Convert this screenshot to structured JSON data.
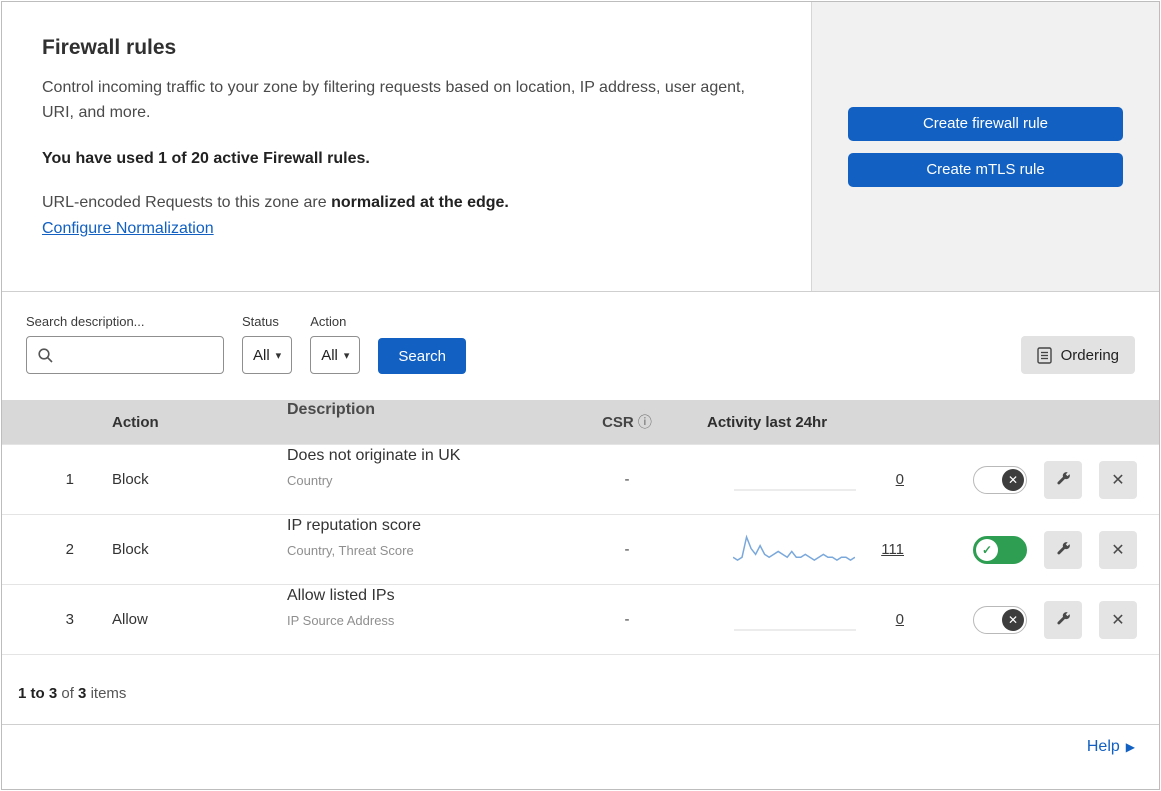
{
  "colors": {
    "blue": "#1160c2",
    "green": "#2e9e52",
    "sparkline": "#7aa8db"
  },
  "icons": {
    "caret": "▾",
    "info": "ⓘ",
    "close": "✕",
    "check": "✓",
    "help_arrow": "▶"
  },
  "header": {
    "title": "Firewall rules",
    "description": "Control incoming traffic to your zone by filtering requests based on location, IP address, user agent, URI, and more.",
    "usage": "You have used 1 of 20 active Firewall rules.",
    "normalization_prefix": "URL-encoded Requests to this zone are ",
    "normalization_bold": "normalized at the edge.",
    "normalization_link": "Configure Normalization",
    "buttons": {
      "create_firewall": "Create firewall rule",
      "create_mtls": "Create mTLS rule"
    }
  },
  "filters": {
    "search_label": "Search description...",
    "status_label": "Status",
    "status_value": "All",
    "action_label": "Action",
    "action_value": "All",
    "search_button": "Search",
    "ordering_button": "Ordering"
  },
  "table": {
    "columns": {
      "action": "Action",
      "description": "Description",
      "csr": "CSR",
      "activity": "Activity last 24hr"
    },
    "rows": [
      {
        "priority": "1",
        "action": "Block",
        "description": "Does not originate in UK",
        "fields": "Country",
        "csr": "-",
        "activity": "0",
        "enabled": false,
        "sparkline": []
      },
      {
        "priority": "2",
        "action": "Block",
        "description": "IP reputation score",
        "fields": "Country, Threat Score",
        "csr": "-",
        "activity": "111",
        "enabled": true,
        "sparkline": [
          2,
          1,
          2,
          9,
          5,
          3,
          6,
          3,
          2,
          3,
          4,
          3,
          2,
          4,
          2,
          2,
          3,
          2,
          1,
          2,
          3,
          2,
          2,
          1,
          2,
          2,
          1,
          2
        ]
      },
      {
        "priority": "3",
        "action": "Allow",
        "description": "Allow listed IPs",
        "fields": "IP Source Address",
        "csr": "-",
        "activity": "0",
        "enabled": false,
        "sparkline": []
      }
    ],
    "footer": {
      "range": "1 to 3",
      "of": "of",
      "count": "3",
      "items_label": "items"
    }
  },
  "footer": {
    "help": "Help"
  }
}
